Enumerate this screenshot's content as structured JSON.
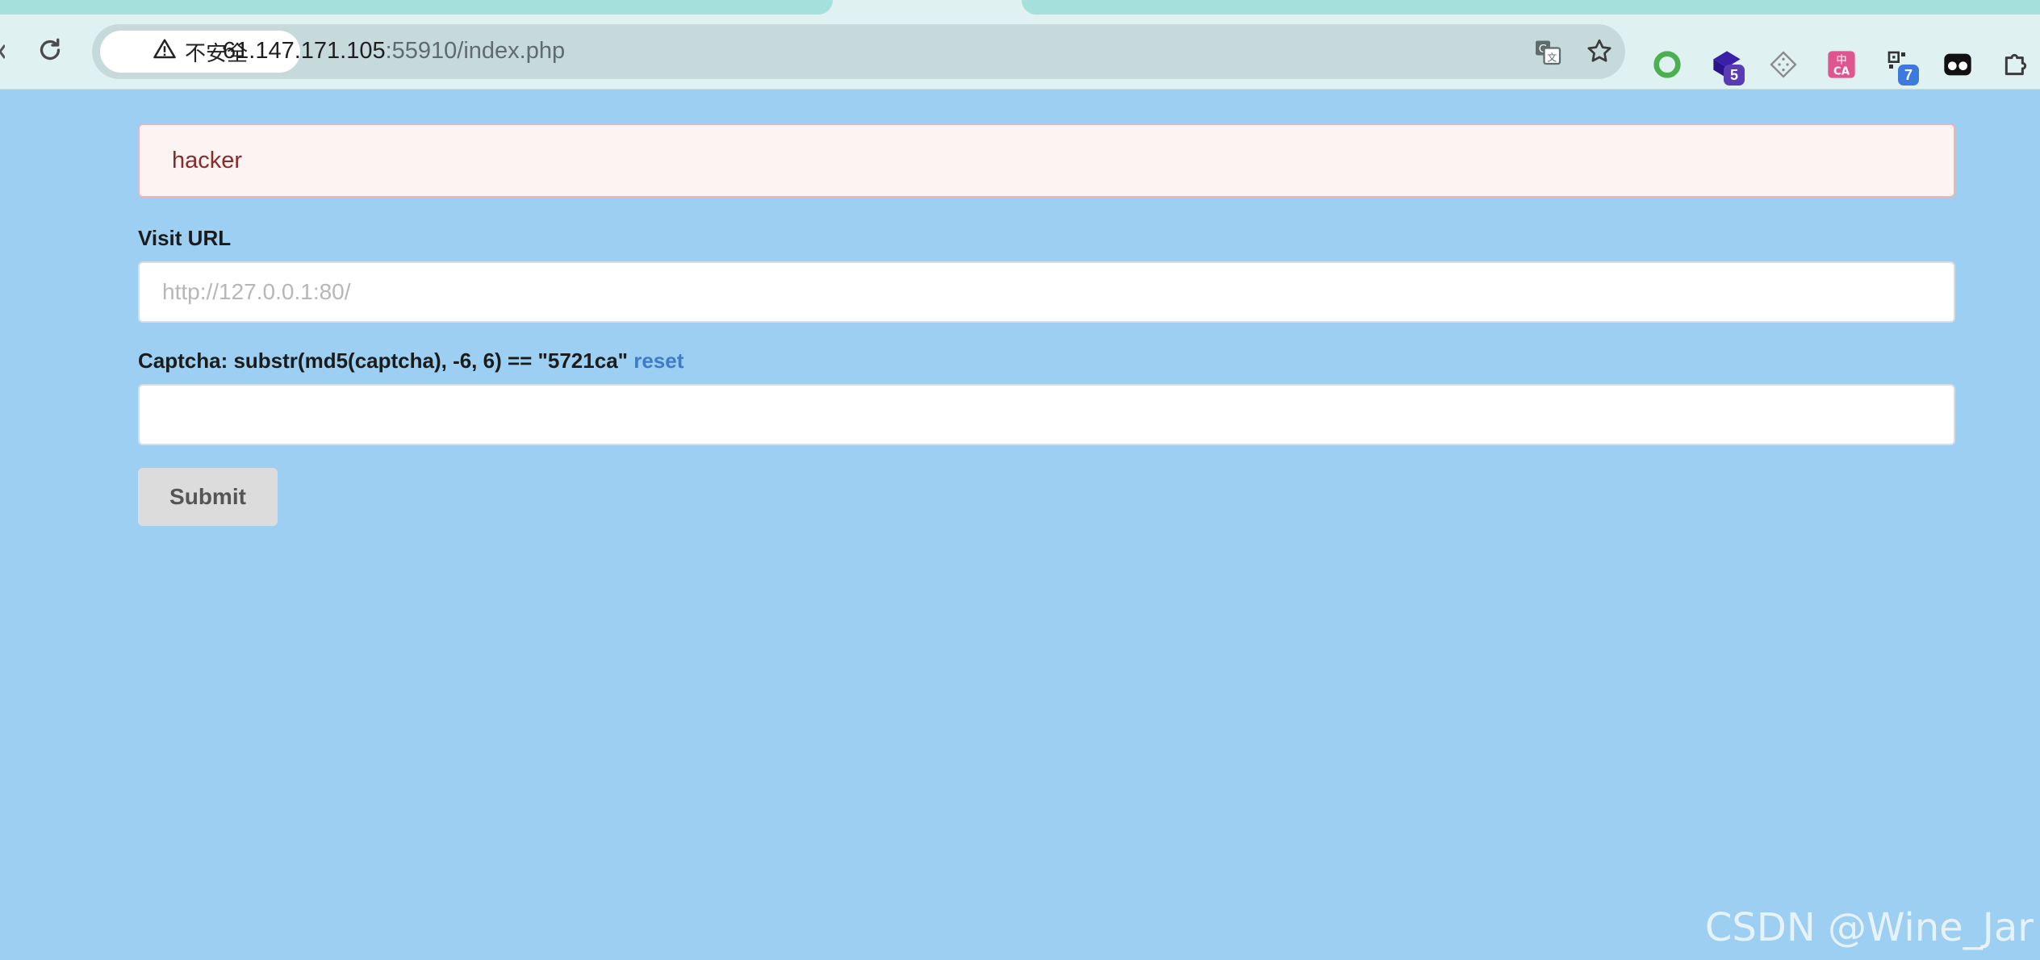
{
  "browser": {
    "security_label": "不安全",
    "url_host": "61.147.171.105",
    "url_port_path": ":55910/index.php",
    "extensions": [
      {
        "icon": "green-ring-extension-icon"
      },
      {
        "icon": "purple-cube-extension-icon",
        "badge": "5",
        "badge_color": "#5b3bb5"
      },
      {
        "icon": "diamond-outline-extension-icon"
      },
      {
        "icon": "translate-ca-extension-icon",
        "color": "#e0558f"
      },
      {
        "icon": "qr-extension-icon",
        "badge": "7",
        "badge_color": "#3d7ae0"
      },
      {
        "icon": "glasses-extension-icon"
      },
      {
        "icon": "puzzle-extensions-icon"
      }
    ]
  },
  "page": {
    "alert_text": "hacker",
    "visit_url_label": "Visit URL",
    "url_placeholder": "http://127.0.0.1:80/",
    "url_value": "",
    "captcha_label": "Captcha: substr(md5(captcha), -6, 6) == \"5721ca\"",
    "reset_label": "reset",
    "captcha_value": "",
    "submit_label": "Submit"
  },
  "watermark": "CSDN @Wine_Jar",
  "colors": {
    "page_background": "#9ccff2",
    "alert_background": "#fcf3f3",
    "alert_text": "#8a2b2b",
    "link": "#3d7cc9"
  }
}
